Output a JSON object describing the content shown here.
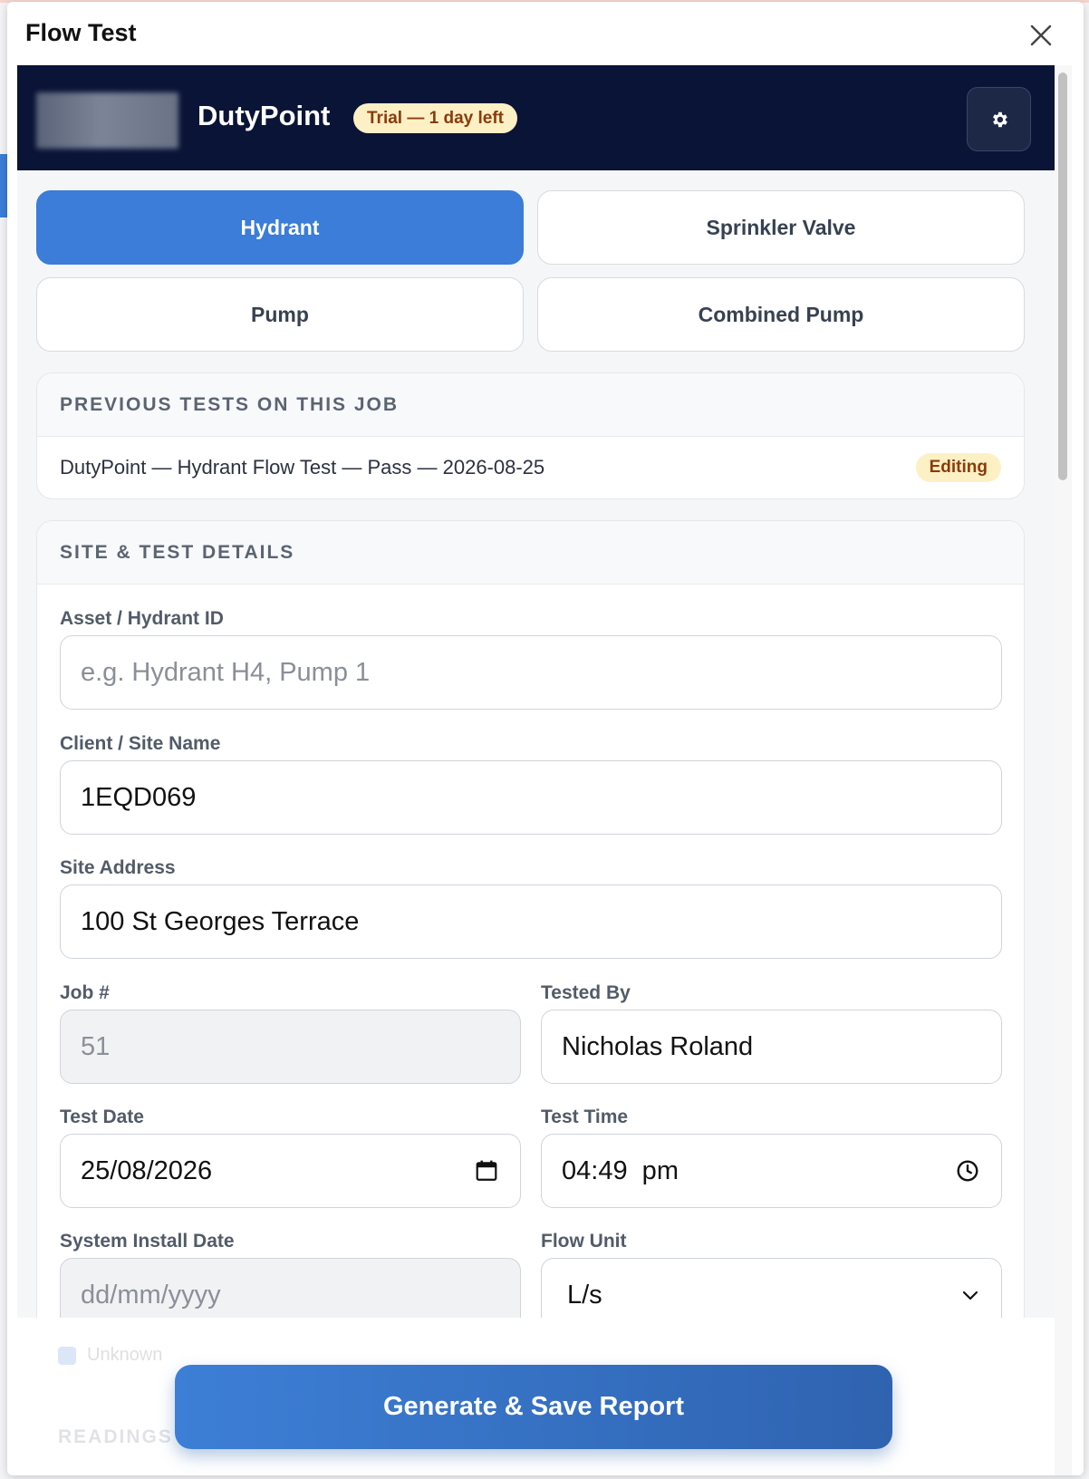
{
  "modal": {
    "title": "Flow Test"
  },
  "header": {
    "brand": "DutyPoint",
    "trial_badge": "Trial — 1 day left",
    "settings_icon": "gear-icon"
  },
  "test_types": [
    {
      "label": "Hydrant",
      "active": true
    },
    {
      "label": "Sprinkler Valve",
      "active": false
    },
    {
      "label": "Pump",
      "active": false
    },
    {
      "label": "Combined Pump",
      "active": false
    }
  ],
  "previous_tests": {
    "title": "PREVIOUS TESTS ON THIS JOB",
    "items": [
      {
        "text": "DutyPoint — Hydrant Flow Test — Pass — 2026-08-25",
        "badge": "Editing"
      }
    ]
  },
  "site_details": {
    "title": "SITE & TEST DETAILS",
    "asset_id": {
      "label": "Asset / Hydrant ID",
      "value": "",
      "placeholder": "e.g. Hydrant H4, Pump 1"
    },
    "client_site": {
      "label": "Client / Site Name",
      "value": "1EQD069"
    },
    "site_address": {
      "label": "Site Address",
      "value": "100 St Georges Terrace"
    },
    "job_number": {
      "label": "Job #",
      "value": "51"
    },
    "tested_by": {
      "label": "Tested By",
      "value": "Nicholas Roland"
    },
    "test_date": {
      "label": "Test Date",
      "value": "25/08/2026"
    },
    "test_time": {
      "label": "Test Time",
      "value": "04:49  pm"
    },
    "install_date": {
      "label": "System Install Date",
      "placeholder": "dd/mm/yyyy"
    },
    "flow_unit": {
      "label": "Flow Unit",
      "value": "L/s"
    },
    "unknown_label": "Unknown"
  },
  "readings_title": "READINGS",
  "actions": {
    "generate": "Generate & Save Report"
  }
}
